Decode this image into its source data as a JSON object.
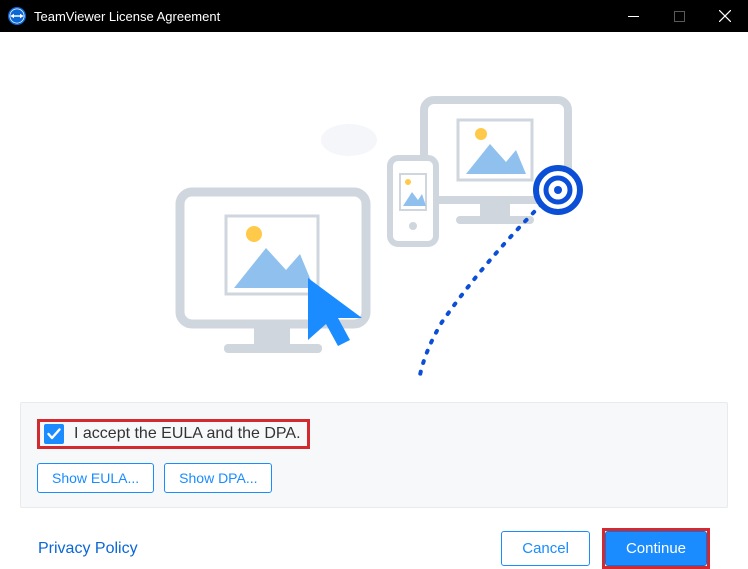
{
  "window": {
    "title": "TeamViewer License Agreement"
  },
  "agreement": {
    "checkbox_label": "I accept the EULA and the DPA.",
    "show_eula": "Show EULA...",
    "show_dpa": "Show DPA..."
  },
  "footer": {
    "privacy": "Privacy Policy",
    "cancel": "Cancel",
    "continue": "Continue"
  }
}
